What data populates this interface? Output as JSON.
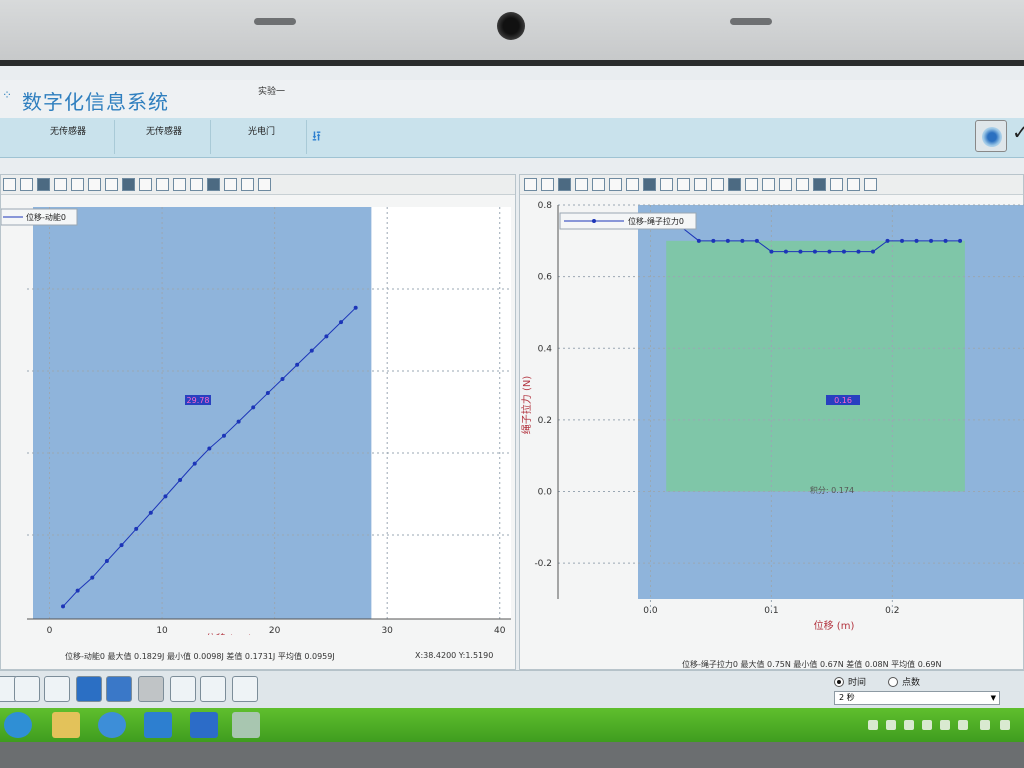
{
  "app": {
    "title": "数字化信息系统",
    "experiment": "实验一"
  },
  "sensors": [
    "无传感器",
    "无传感器",
    "光电门"
  ],
  "icons": {
    "logo": "dots-logo-icon",
    "usb": "usb-icon",
    "eye": "eye-icon",
    "check": "check-icon"
  },
  "left_chart_stats": "位移-动能0 最大值 0.1829J 最小值 0.0098J 差值 0.1731J 平均值 0.0959J",
  "left_chart_coords": "X:38.4200 Y:1.5190",
  "right_chart_stats": "位移-绳子拉力0 最大值 0.75N 最小值 0.67N 差值 0.08N 平均值 0.69N",
  "sampling": {
    "time_label": "时间",
    "points_label": "点数",
    "interval_value": "2 秒"
  },
  "chart_data": [
    {
      "type": "line",
      "legend": "位移-动能0",
      "xlabel": "位移 (cm)",
      "ylabel": "",
      "xlim": [
        -2,
        41
      ],
      "ylim": [
        0,
        0.2
      ],
      "x_ticks": [
        0,
        10,
        20,
        30,
        40
      ],
      "grid": true,
      "legend_position": "top-left",
      "series": [
        {
          "name": "位移-动能0",
          "x": [
            1.2,
            2.5,
            3.8,
            5.1,
            6.4,
            7.7,
            9.0,
            10.3,
            11.6,
            12.9,
            14.2,
            15.5,
            16.8,
            18.1,
            19.4,
            20.7,
            22.0,
            23.3,
            24.6,
            25.9,
            27.2
          ],
          "y": [
            0.0098,
            0.0173,
            0.0235,
            0.0314,
            0.039,
            0.0467,
            0.0544,
            0.0622,
            0.07,
            0.0778,
            0.085,
            0.0911,
            0.0978,
            0.1046,
            0.1114,
            0.1181,
            0.1249,
            0.1316,
            0.1384,
            0.1452,
            0.152
          ]
        }
      ],
      "annotation": "29.78",
      "background_colors": [
        "#8fb4db",
        "#ffffff"
      ]
    },
    {
      "type": "line",
      "legend": "位移-绳子拉力0",
      "xlabel": "位移 (m)",
      "ylabel": "绳子拉力 (N)",
      "xlim": [
        -0.05,
        0.27
      ],
      "ylim": [
        -0.3,
        0.8
      ],
      "x_ticks": [
        0.0,
        0.1,
        0.2
      ],
      "y_ticks": [
        -0.2,
        0.0,
        0.2,
        0.4,
        0.6,
        0.8
      ],
      "grid": true,
      "legend_position": "top-left",
      "series": [
        {
          "name": "位移-绳子拉力0",
          "x": [
            0.04,
            0.052,
            0.064,
            0.076,
            0.088,
            0.1,
            0.112,
            0.124,
            0.136,
            0.148,
            0.16,
            0.172,
            0.184,
            0.196,
            0.208,
            0.22,
            0.232,
            0.244,
            0.256
          ],
          "y": [
            0.7,
            0.7,
            0.7,
            0.7,
            0.7,
            0.67,
            0.67,
            0.67,
            0.67,
            0.67,
            0.67,
            0.67,
            0.67,
            0.7,
            0.7,
            0.7,
            0.7,
            0.7,
            0.7
          ]
        }
      ],
      "annotation": "0.16",
      "integral_label": "积分: 0.174",
      "integral_range": [
        0.013,
        0.26
      ],
      "background_colors": [
        "#8fb4db",
        "#7fc6a8"
      ]
    }
  ]
}
